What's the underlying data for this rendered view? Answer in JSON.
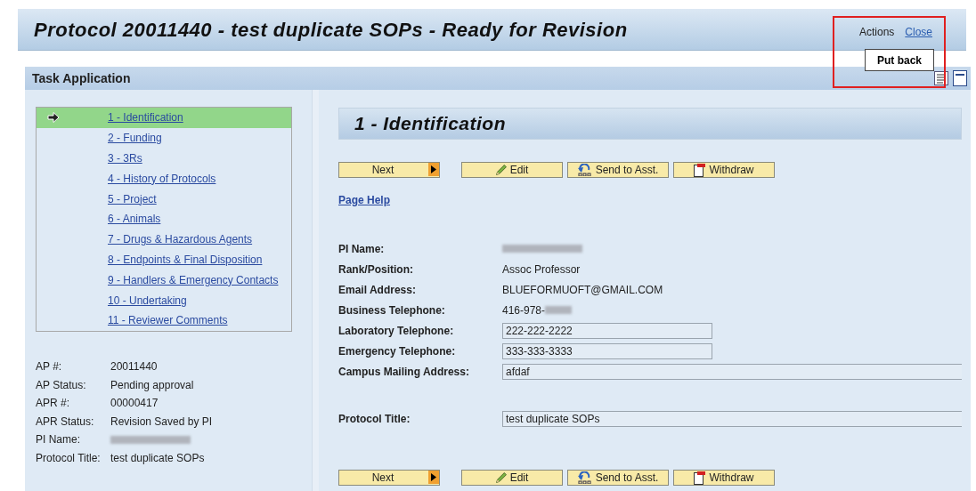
{
  "header": {
    "title": "Protocol 20011440 - test duplicate SOPs - Ready for Revision",
    "actions_label": "Actions",
    "close_link": "Close",
    "popup_item": "Put back"
  },
  "panel": {
    "title": "Task Application"
  },
  "nav": [
    {
      "label": "1 - Identification",
      "selected": true
    },
    {
      "label": "2 - Funding",
      "selected": false
    },
    {
      "label": "3 - 3Rs",
      "selected": false
    },
    {
      "label": "4 - History of Protocols",
      "selected": false
    },
    {
      "label": "5 - Project",
      "selected": false
    },
    {
      "label": "6 - Animals",
      "selected": false
    },
    {
      "label": "7 - Drugs & Hazardous Agents",
      "selected": false
    },
    {
      "label": "8 - Endpoints & Final Disposition",
      "selected": false
    },
    {
      "label": "9 - Handlers & Emergency Contacts",
      "selected": false
    },
    {
      "label": "10 - Undertaking",
      "selected": false
    },
    {
      "label": "11 - Reviewer Comments",
      "selected": false
    }
  ],
  "summary": [
    {
      "label": "AP #:",
      "value": "20011440"
    },
    {
      "label": "AP Status:",
      "value": "Pending approval"
    },
    {
      "label": "APR #:",
      "value": "00000417"
    },
    {
      "label": "APR Status:",
      "value": "Revision Saved by PI"
    },
    {
      "label": "PI Name:",
      "redacted": true
    },
    {
      "label": "Protocol Title:",
      "value": "test duplicate SOPs"
    }
  ],
  "section_title": "1 - Identification",
  "buttons": [
    {
      "kind": "next",
      "label": "Next"
    },
    {
      "kind": "edit",
      "label": "Edit"
    },
    {
      "kind": "send",
      "label": "Send to Asst."
    },
    {
      "kind": "withdraw",
      "label": "Withdraw"
    }
  ],
  "page_help": "Page Help",
  "fields": [
    {
      "kind": "text",
      "label": "PI Name:",
      "redacted": true
    },
    {
      "kind": "text",
      "label": "Rank/Position:",
      "value": "Assoc Professor"
    },
    {
      "kind": "text",
      "label": "Email Address:",
      "value": "BLUEFORMUOFT@GMAIL.COM"
    },
    {
      "kind": "text",
      "label": "Business Telephone:",
      "value": "416-978-",
      "redacted": true
    },
    {
      "kind": "input",
      "label": "Laboratory Telephone:",
      "value": "222-222-2222"
    },
    {
      "kind": "input",
      "label": "Emergency Telephone:",
      "value": "333-333-3333"
    },
    {
      "kind": "wide",
      "label": "Campus Mailing Address:",
      "value": "afdaf"
    },
    {
      "kind": "gap"
    },
    {
      "kind": "wide",
      "label": "Protocol Title:",
      "value": "test duplicate SOPs"
    }
  ],
  "bottom_buttons": [
    {
      "kind": "next",
      "label": "Next"
    },
    {
      "kind": "edit",
      "label": "Edit"
    },
    {
      "kind": "send",
      "label": "Send to Asst."
    },
    {
      "kind": "withdraw",
      "label": "Withdraw"
    }
  ]
}
